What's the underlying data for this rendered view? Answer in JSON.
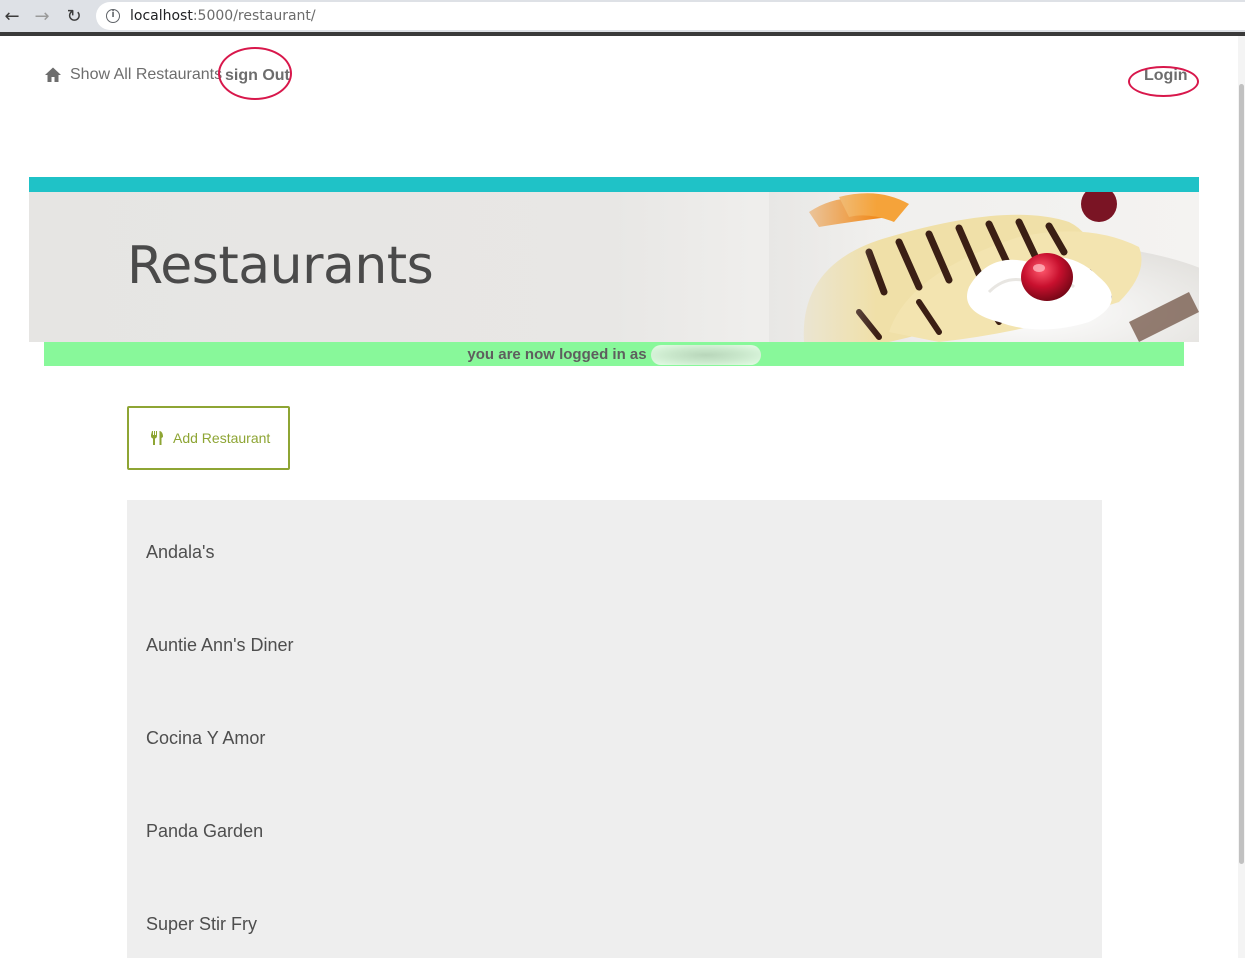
{
  "browser": {
    "url_host": "localhost",
    "url_path": ":5000/restaurant/"
  },
  "nav": {
    "home_label": "Show All Restaurants",
    "signout_label": "sign Out",
    "login_label": "Login"
  },
  "banner": {
    "title": "Restaurants"
  },
  "flash": {
    "message": "you are now logged in as"
  },
  "actions": {
    "add_restaurant_label": "Add Restaurant"
  },
  "restaurants": [
    {
      "name": "Andala's"
    },
    {
      "name": "Auntie Ann's Diner"
    },
    {
      "name": "Cocina Y Amor"
    },
    {
      "name": "Panda Garden"
    },
    {
      "name": "Super Stir Fry"
    }
  ],
  "colors": {
    "accent_teal": "#1fc2c7",
    "flash_green": "#88f89a",
    "button_olive": "#8ea534",
    "annotation_red": "#d8174b",
    "list_bg": "#eeeeee"
  }
}
